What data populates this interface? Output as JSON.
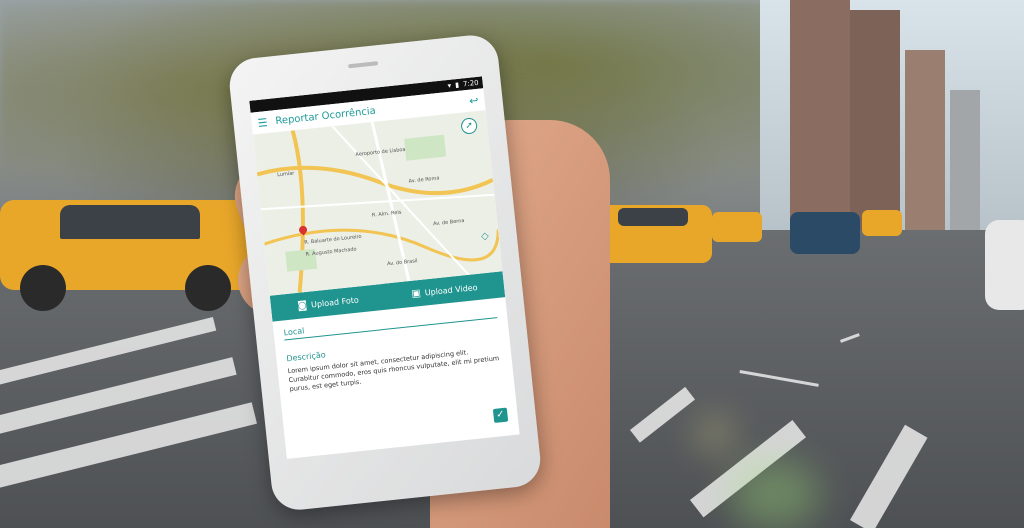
{
  "status": {
    "time": "7:20"
  },
  "app": {
    "title": "Reportar Ocorrência",
    "menu_icon": "menu-icon",
    "back_icon": "back-arrow-icon"
  },
  "map": {
    "labels": [
      "Aeroporto de Lisboa",
      "Av. de Roma",
      "R. Baluarte do Loureiro",
      "R. Augusto Machado",
      "Lumiar",
      "Av. do Brasil",
      "R. Alm. Reis",
      "Av. de Berna"
    ],
    "compass_icon": "compass-icon",
    "locate_icon": "locate-icon"
  },
  "actions": {
    "upload_photo": "Upload Foto",
    "upload_video": "Upload Video",
    "photo_icon": "camera-icon",
    "video_icon": "video-icon"
  },
  "form": {
    "local_label": "Local",
    "description_label": "Descrição",
    "description_text": "Lorem ipsum dolor sit amet, consectetur adipiscing elit. Curabitur commodo, eros quis rhoncus vulputate, elit mi pretium purus, est eget turpis.",
    "confirm_icon": "checkmark-icon"
  },
  "colors": {
    "accent": "#20948f",
    "taxi": "#e9a72a"
  }
}
